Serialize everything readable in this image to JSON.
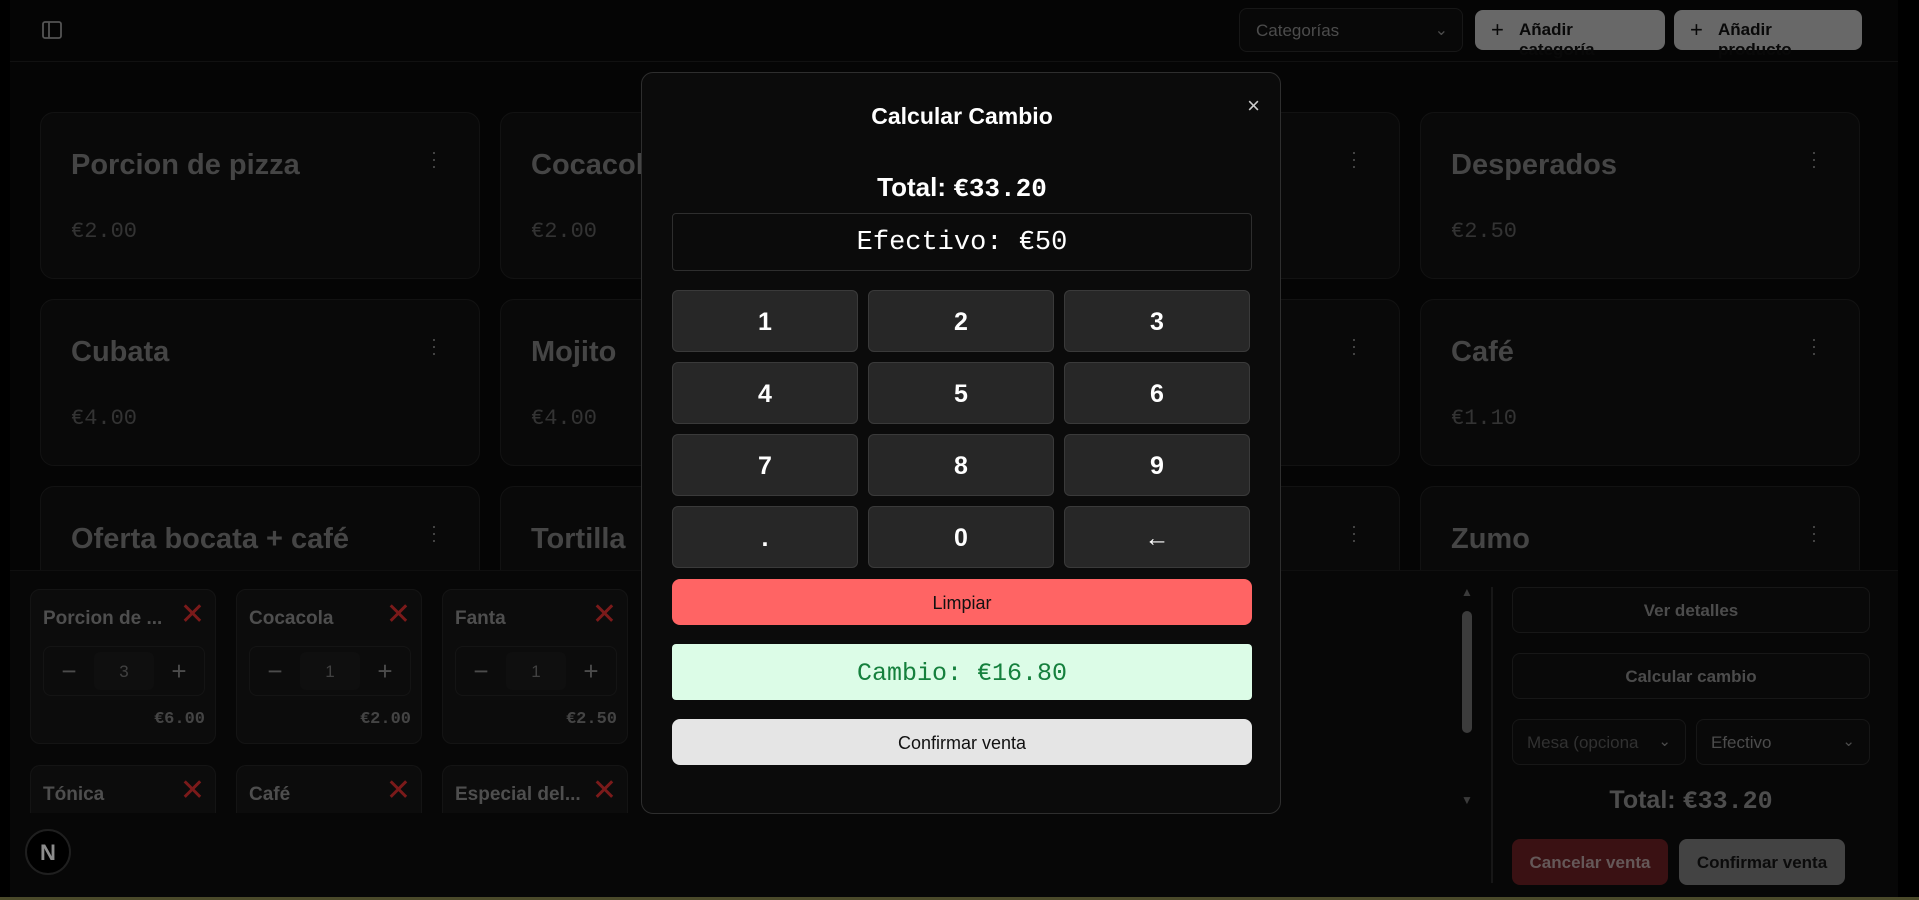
{
  "header": {
    "categories_select": {
      "value": "Categorías"
    },
    "add_category_label": "Añadir categoría",
    "add_product_label": "Añadir producto"
  },
  "products": [
    {
      "name": "Porcion de pizza",
      "price": "€2.00"
    },
    {
      "name": "Cocacola",
      "price": "€2.00"
    },
    {
      "name": "Desperados",
      "price": "€2.50"
    },
    {
      "name": "Cubata",
      "price": "€4.00"
    },
    {
      "name": "Mojito",
      "price": "€4.00"
    },
    {
      "name": "Café",
      "price": "€1.10"
    },
    {
      "name": "Oferta bocata + café"
    },
    {
      "name": "Tortilla"
    },
    {
      "name": "Zumo"
    }
  ],
  "cart": {
    "items": [
      {
        "name": "Porcion de ...",
        "qty": "3",
        "total": "€6.00"
      },
      {
        "name": "Cocacola",
        "qty": "1",
        "total": "€2.00"
      },
      {
        "name": "Fanta",
        "qty": "1",
        "total": "€2.50"
      },
      {
        "name": "Tónica"
      },
      {
        "name": "Café"
      },
      {
        "name": "Especial del..."
      }
    ],
    "view_details_label": "Ver detalles",
    "calc_change_label": "Calcular cambio",
    "table_select_placeholder": "Mesa (opciona",
    "payment_select_value": "Efectivo",
    "total_label": "Total:",
    "total_value": "€33.20",
    "cancel_label": "Cancelar venta",
    "confirm_label": "Confirmar venta"
  },
  "modal": {
    "title": "Calcular Cambio",
    "close_symbol": "×",
    "total_label": "Total:",
    "total_value": "€33.20",
    "cash_display": "Efectivo: €50",
    "keys": [
      "1",
      "2",
      "3",
      "4",
      "5",
      "6",
      "7",
      "8",
      "9",
      ".",
      "0",
      "←"
    ],
    "clear_label": "Limpiar",
    "change_display": "Cambio: €16.80",
    "confirm_label": "Confirmar venta"
  },
  "badge": {
    "letter": "N"
  },
  "colors": {
    "clear_bg": "#ff6464",
    "change_bg": "#dcfce7",
    "change_text": "#15803d",
    "remove_icon": "#e03131",
    "cancel_bg": "#6b1f24"
  }
}
